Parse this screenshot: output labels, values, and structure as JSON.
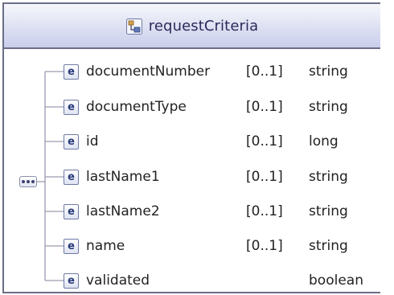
{
  "node": {
    "title": "requestCriteria",
    "title_icon": "complex-type-icon"
  },
  "compositor": {
    "icon": "sequence-icon"
  },
  "elements": [
    {
      "icon_letter": "e",
      "name": "documentNumber",
      "cardinality": "[0..1]",
      "type": "string"
    },
    {
      "icon_letter": "e",
      "name": "documentType",
      "cardinality": "[0..1]",
      "type": "string"
    },
    {
      "icon_letter": "e",
      "name": "id",
      "cardinality": "[0..1]",
      "type": "long"
    },
    {
      "icon_letter": "e",
      "name": "lastName1",
      "cardinality": "[0..1]",
      "type": "string"
    },
    {
      "icon_letter": "e",
      "name": "lastName2",
      "cardinality": "[0..1]",
      "type": "string"
    },
    {
      "icon_letter": "e",
      "name": "name",
      "cardinality": "[0..1]",
      "type": "string"
    },
    {
      "icon_letter": "e",
      "name": "validated",
      "cardinality": "",
      "type": "boolean"
    }
  ],
  "colors": {
    "border": "#6b6e86",
    "header_gradient_top": "#f6f7fc",
    "header_gradient_bottom": "#c9cdea",
    "connector": "#9a9cb0",
    "icon_letter": "#273a78"
  }
}
